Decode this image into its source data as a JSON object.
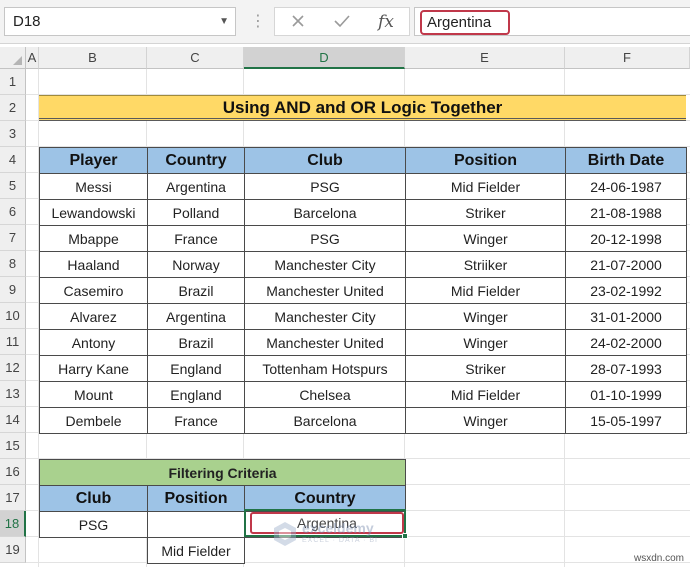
{
  "formula_bar": {
    "cell_ref": "D18",
    "value": "Argentina",
    "cancel_icon": "x-icon",
    "enter_icon": "check-icon",
    "function_icon": "fx-icon"
  },
  "columns": [
    "A",
    "B",
    "C",
    "D",
    "E",
    "F"
  ],
  "rows": [
    "1",
    "2",
    "3",
    "4",
    "5",
    "6",
    "7",
    "8",
    "9",
    "10",
    "11",
    "12",
    "13",
    "14",
    "15",
    "16",
    "17",
    "18",
    "19"
  ],
  "title": "Using AND and OR Logic Together",
  "players_table": {
    "headers": [
      "Player",
      "Country",
      "Club",
      "Position",
      "Birth Date"
    ],
    "rows": [
      [
        "Messi",
        "Argentina",
        "PSG",
        "Mid Fielder",
        "24-06-1987"
      ],
      [
        "Lewandowski",
        "Polland",
        "Barcelona",
        "Striker",
        "21-08-1988"
      ],
      [
        "Mbappe",
        "France",
        "PSG",
        "Winger",
        "20-12-1998"
      ],
      [
        "Haaland",
        "Norway",
        "Manchester City",
        "Striiker",
        "21-07-2000"
      ],
      [
        "Casemiro",
        "Brazil",
        "Manchester United",
        "Mid Fielder",
        "23-02-1992"
      ],
      [
        "Alvarez",
        "Argentina",
        "Manchester City",
        "Winger",
        "31-01-2000"
      ],
      [
        "Antony",
        "Brazil",
        "Manchester United",
        "Winger",
        "24-02-2000"
      ],
      [
        "Harry Kane",
        "England",
        "Tottenham Hotspurs",
        "Striker",
        "28-07-1993"
      ],
      [
        "Mount",
        "England",
        "Chelsea",
        "Mid Fielder",
        "01-10-1999"
      ],
      [
        "Dembele",
        "France",
        "Barcelona",
        "Winger",
        "15-05-1997"
      ]
    ]
  },
  "criteria_table": {
    "title": "Filtering Criteria",
    "headers": [
      "Club",
      "Position",
      "Country"
    ],
    "row1": [
      "PSG",
      "",
      "Argentina"
    ],
    "row2": [
      "",
      "Mid Fielder",
      ""
    ]
  },
  "watermark": {
    "name": "exceldemy",
    "tagline": "EXCEL · DATA · BI"
  },
  "site": "wsxdn.com",
  "colors": {
    "title_fill": "#ffd966",
    "header_fill": "#9dc3e6",
    "criteria_title_fill": "#a9d18e",
    "selection": "#217346",
    "highlight": "#c0384a"
  }
}
